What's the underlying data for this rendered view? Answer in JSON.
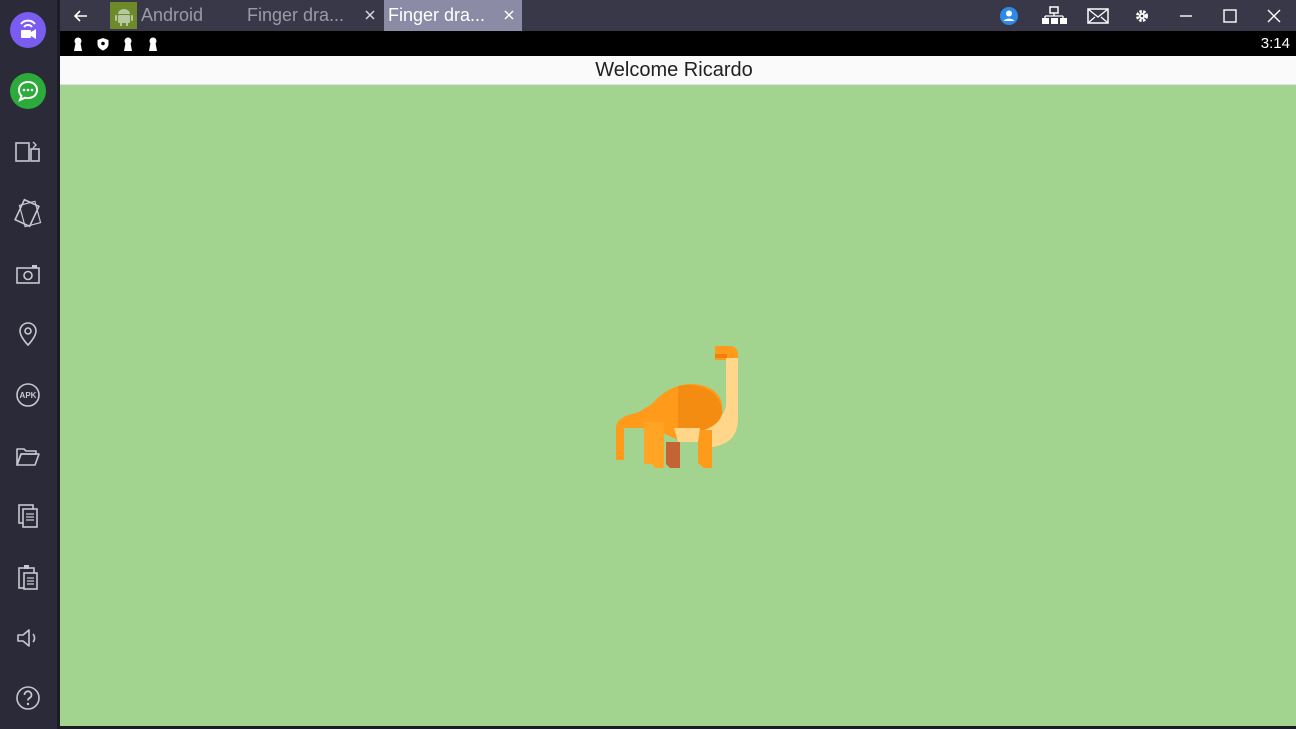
{
  "window": {
    "tabs": [
      {
        "label": "Android",
        "active": false,
        "closable": false
      },
      {
        "label": "Finger dra...",
        "active": false,
        "closable": true
      },
      {
        "label": "Finger dra...",
        "active": true,
        "closable": true
      }
    ],
    "controls": [
      "account-icon",
      "network-icon",
      "mail-icon",
      "settings-icon",
      "minimize-icon",
      "maximize-icon",
      "close-icon"
    ]
  },
  "sidebar": {
    "items": [
      "video-call-icon",
      "chat-icon",
      "multi-window-icon",
      "rotate-icon",
      "screenshot-icon",
      "location-icon",
      "apk-icon",
      "folder-icon",
      "copy-icon",
      "paste-icon",
      "volume-icon",
      "help-icon"
    ],
    "apk_label": "APK"
  },
  "status_bar": {
    "time": "3:14",
    "notification_icons": [
      "keyhole-icon",
      "shield-icon",
      "keyhole-icon",
      "keyhole-icon"
    ]
  },
  "app": {
    "title": "Welcome Ricardo",
    "background": "#a2d490",
    "image": "dinosaur-icon"
  },
  "colors": {
    "sidebar_bg": "#2a2a38",
    "titlebar_bg": "#383848",
    "active_tab_bg": "#8b8ba6",
    "dino_orange": "#ff9a1a",
    "dino_cream": "#ffd68a"
  }
}
